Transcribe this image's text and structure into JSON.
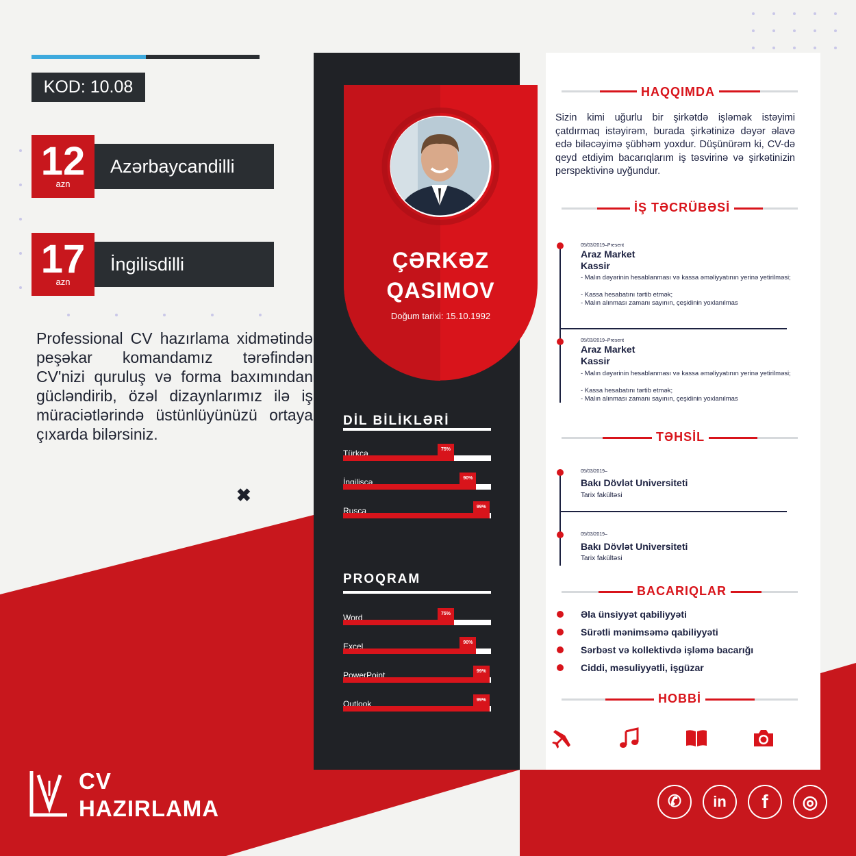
{
  "colors": {
    "red": "#d8141b",
    "dark": "#202226",
    "accent_blue": "#3da9dd"
  },
  "left": {
    "code": "KOD: 10.08",
    "prices": [
      {
        "amount": "12",
        "currency": "azn",
        "label": "Azərbaycandilli"
      },
      {
        "amount": "17",
        "currency": "azn",
        "label": "İngilisdilli"
      }
    ],
    "promo": "Professional CV hazırlama xidmətində peşəkar komandamız tərəfindən CV'nizi quruluş və forma baxımından gücləndirib, özəl dizaynlarımız ilə iş müraciətlərində üstünlüyünüzü ortaya çıxarda bilərsiniz.",
    "close_glyph": "✖"
  },
  "brand": {
    "line1": "CV",
    "line2": "HAZIRLAMA"
  },
  "cv": {
    "first_name": "ÇƏRKƏZ",
    "last_name": "QASIMOV",
    "birth": "Doğum tarixi: 15.10.1992",
    "languages_title": "DİL BİLİKLƏRİ",
    "languages": [
      {
        "name": "Türkcə",
        "pct": "75%",
        "value": 0.75
      },
      {
        "name": "İngiliscə",
        "pct": "90%",
        "value": 0.9
      },
      {
        "name": "Rusca",
        "pct": "99%",
        "value": 0.99
      }
    ],
    "programs_title": "PROQRAM",
    "programs": [
      {
        "name": "Word",
        "pct": "75%",
        "value": 0.75
      },
      {
        "name": "Excel",
        "pct": "90%",
        "value": 0.9
      },
      {
        "name": "PowerPoint",
        "pct": "99%",
        "value": 0.99
      },
      {
        "name": "Outlook",
        "pct": "99%",
        "value": 0.99
      }
    ],
    "about_title": "HAQQIMDA",
    "about": "Sizin kimi uğurlu bir şirkətdə işləmək istəyimi çatdırmaq istəyirəm, burada şirkətinizə dəyər əlavə edə biləcəyimə şübhəm yoxdur. Düşünürəm ki, CV-də qeyd etdiyim bacarıqlarım iş təsvirinə və şirkətinizin perspektivinə uyğundur.",
    "experience_title": "İŞ TƏCRÜBƏSİ",
    "experience": [
      {
        "date": "05/03/2019–Present",
        "company": "Araz Market",
        "role": "Kassir",
        "bullets": [
          "- Malın dəyərinin hesablanması və kassa əməliyyatının yerinə yetirilməsi;",
          "- Kassa hesabatını tərtib etmək;",
          "- Malın alınması zamanı sayının, çeşidinin yoxlanılmas"
        ]
      },
      {
        "date": "05/03/2019–Present",
        "company": "Araz Market",
        "role": "Kassir",
        "bullets": [
          "- Malın dəyərinin hesablanması və kassa əməliyyatının yerinə yetirilməsi;",
          "- Kassa hesabatını tərtib etmək;",
          "- Malın alınması zamanı sayının, çeşidinin yoxlanılmas"
        ]
      }
    ],
    "education_title": "TƏHSİL",
    "education": [
      {
        "date": "05/03/2019–",
        "school": "Bakı Dövlət Universiteti",
        "faculty": "Tarix fakültəsi"
      },
      {
        "date": "05/03/2019–",
        "school": "Bakı Dövlət Universiteti",
        "faculty": "Tarix fakültəsi"
      }
    ],
    "skills_title": "BACARIQLAR",
    "skills": [
      "Əla ünsiyyət qabiliyyəti",
      "Sürətli mənimsəmə qabiliyyəti",
      "Sərbəst və kollektivdə işləmə bacarığı",
      "Ciddi, məsuliyyətli, işgüzar"
    ],
    "hobby_title": "HOBBİ",
    "hobbies": [
      "airplane-icon",
      "music-icon",
      "book-icon",
      "camera-icon"
    ]
  },
  "social": [
    {
      "icon": "whatsapp-icon",
      "glyph": "✆"
    },
    {
      "icon": "linkedin-icon",
      "glyph": "in"
    },
    {
      "icon": "facebook-icon",
      "glyph": "f"
    },
    {
      "icon": "instagram-icon",
      "glyph": "◎"
    }
  ]
}
